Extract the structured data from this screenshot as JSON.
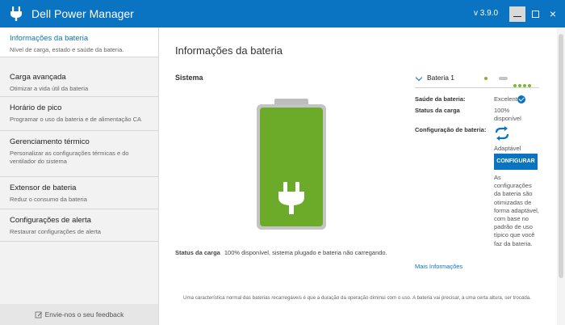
{
  "app": {
    "title": "Dell Power Manager",
    "version": "v 3.9.0",
    "window_controls": {
      "minimize": "minimize-icon",
      "maximize": "maximize-icon",
      "close": "×"
    }
  },
  "sidebar": {
    "items": [
      {
        "label": "Informações da bateria",
        "description": "Nível de carga, estado e saúde da bateria.",
        "active": true
      },
      {
        "label": "Carga avançada",
        "description": "Otimizar a vida útil da bateria",
        "active": false
      },
      {
        "label": "Horário de pico",
        "description": "Programar o uso da bateria e de alimentação CA",
        "active": false
      },
      {
        "label": "Gerenciamento térmico",
        "description": "Personalizar as configurações térmicas e do ventilador do sistema",
        "active": false
      },
      {
        "label": "Extensor de bateria",
        "description": "Reduz o consumo da bateria",
        "active": false
      },
      {
        "label": "Configurações de alerta",
        "description": "Restaurar configurações de alerta",
        "active": false
      }
    ],
    "feedback": "Envie-nos o seu feedback"
  },
  "main": {
    "title": "Informações da bateria",
    "section": "Sistema",
    "battery_level": 1.0,
    "status_label": "Status da carga",
    "status_text": "100% disponível, sistema plugado e bateria não carregando.",
    "battery_panel": {
      "name": "Bateria 1",
      "health_label": "Saúde da bateria:",
      "health_value": "Excelente",
      "charge_label": "Status da carga",
      "charge_value": "100% disponível",
      "config_label": "Configuração de bateria:",
      "config_value": "Adaptável",
      "config_button": "CONFIGURAR",
      "config_description": "As configurações da bateria são otimizadas de forma adaptável, com base no padrão de uso típico que você faz da bateria."
    },
    "more_info": "Mais Informações",
    "footnote": "Uma característica normal das baterias recarregáveis é que a duração da operação diminui com o uso. A bateria vai precisar, a uma certa altura, ser trocada."
  },
  "colors": {
    "accent": "#0a73c2",
    "battery_green": "#6cab2a",
    "battery_gray": "#c4c4c4"
  }
}
